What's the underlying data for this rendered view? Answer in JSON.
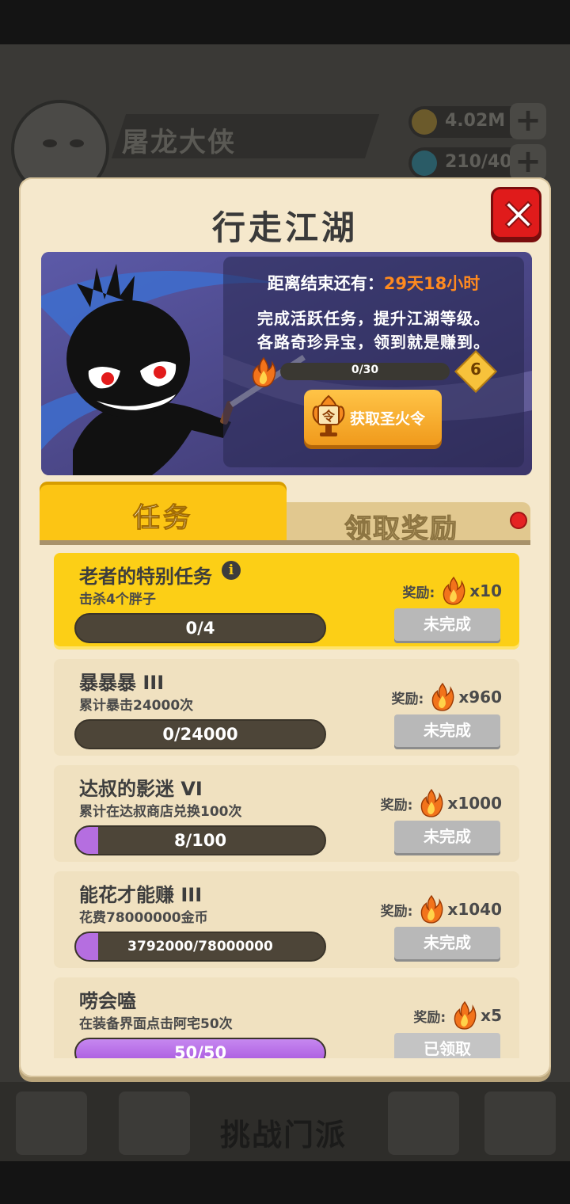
{
  "background": {
    "player_name": "屠龙大侠",
    "resources": [
      {
        "value": "4.02M",
        "icon": "gold-coin-icon"
      },
      {
        "value": "210/40",
        "icon": "energy-drop-icon"
      }
    ],
    "bottom_center_label": "挑战门派"
  },
  "modal": {
    "title": "行走江湖",
    "close_icon": "close-x-icon",
    "banner": {
      "countdown_label": "距离结束还有：",
      "countdown_value": "29天18小时",
      "desc_line1": "完成活跃任务，提升江湖等级。",
      "desc_line2": "各路奇珍异宝，领到就是赚到。",
      "level_progress": "0/30",
      "level": "6",
      "get_token_label": "获取圣火令",
      "token_icon_char": "令"
    },
    "tabs": [
      {
        "label": "任务",
        "active": true
      },
      {
        "label": "领取奖励",
        "active": false,
        "has_dot": true
      }
    ],
    "reward_label": "奖励:",
    "tasks": [
      {
        "title": "老者的特别任务",
        "desc": "击杀4个胖子",
        "progress": "0/4",
        "fraction": 0,
        "reward": "x10",
        "status": "未完成",
        "highlight": true,
        "info": true
      },
      {
        "title": "暴暴暴 III",
        "desc": "累计暴击24000次",
        "progress": "0/24000",
        "fraction": 0,
        "reward": "x960",
        "status": "未完成"
      },
      {
        "title": "达叔的影迷 VI",
        "desc": "累计在达叔商店兑换100次",
        "progress": "8/100",
        "fraction": 0.08,
        "reward": "x1000",
        "status": "未完成"
      },
      {
        "title": "能花才能赚 III",
        "desc": "花费78000000金币",
        "progress": "3792000/78000000",
        "fraction": 0.05,
        "reward": "x1040",
        "status": "未完成"
      },
      {
        "title": "唠会嗑",
        "desc": "在装备界面点击阿宅50次",
        "progress": "50/50",
        "fraction": 1,
        "reward": "x5",
        "status": "已领取"
      }
    ]
  },
  "colors": {
    "tab_active": "#fcc514",
    "progress_fill": "#b56ee0",
    "countdown": "#ff8a1f",
    "close_button": "#e01b1b"
  }
}
